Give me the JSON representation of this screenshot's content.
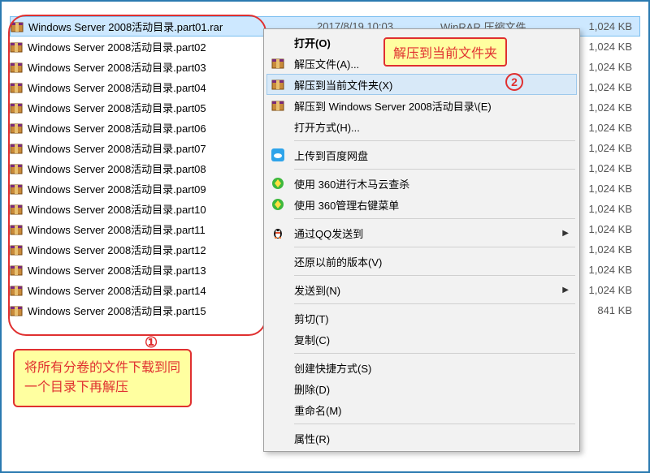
{
  "files": [
    {
      "name": "Windows Server 2008活动目录.part01.rar",
      "date": "2017/8/19 10:03",
      "type": "WinRAR 压缩文件",
      "size": "1,024 KB",
      "selected": true
    },
    {
      "name": "Windows Server 2008活动目录.part02",
      "size": "1,024 KB"
    },
    {
      "name": "Windows Server 2008活动目录.part03",
      "size": "1,024 KB"
    },
    {
      "name": "Windows Server 2008活动目录.part04",
      "size": "1,024 KB"
    },
    {
      "name": "Windows Server 2008活动目录.part05",
      "size": "1,024 KB"
    },
    {
      "name": "Windows Server 2008活动目录.part06",
      "size": "1,024 KB"
    },
    {
      "name": "Windows Server 2008活动目录.part07",
      "size": "1,024 KB"
    },
    {
      "name": "Windows Server 2008活动目录.part08",
      "size": "1,024 KB"
    },
    {
      "name": "Windows Server 2008活动目录.part09",
      "size": "1,024 KB"
    },
    {
      "name": "Windows Server 2008活动目录.part10",
      "size": "1,024 KB"
    },
    {
      "name": "Windows Server 2008活动目录.part11",
      "size": "1,024 KB"
    },
    {
      "name": "Windows Server 2008活动目录.part12",
      "size": "1,024 KB"
    },
    {
      "name": "Windows Server 2008活动目录.part13",
      "size": "1,024 KB"
    },
    {
      "name": "Windows Server 2008活动目录.part14",
      "size": "1,024 KB"
    },
    {
      "name": "Windows Server 2008活动目录.part15",
      "size": "841 KB"
    }
  ],
  "annotations": {
    "num1": "①",
    "num2": "2",
    "callout_top": "解压到当前文件夹",
    "callout_bottom": "将所有分卷的文件下载到同一个目录下再解压"
  },
  "menu": {
    "open": "打开(O)",
    "extract_files": "解压文件(A)...",
    "extract_here": "解压到当前文件夹(X)",
    "extract_to": "解压到 Windows Server 2008活动目录\\(E)",
    "open_with": "打开方式(H)...",
    "baidu": "上传到百度网盘",
    "scan360": "使用 360进行木马云查杀",
    "menu360": "使用 360管理右键菜单",
    "qq": "通过QQ发送到",
    "restore": "还原以前的版本(V)",
    "send_to": "发送到(N)",
    "cut": "剪切(T)",
    "copy": "复制(C)",
    "shortcut": "创建快捷方式(S)",
    "delete": "删除(D)",
    "rename": "重命名(M)",
    "properties": "属性(R)"
  }
}
